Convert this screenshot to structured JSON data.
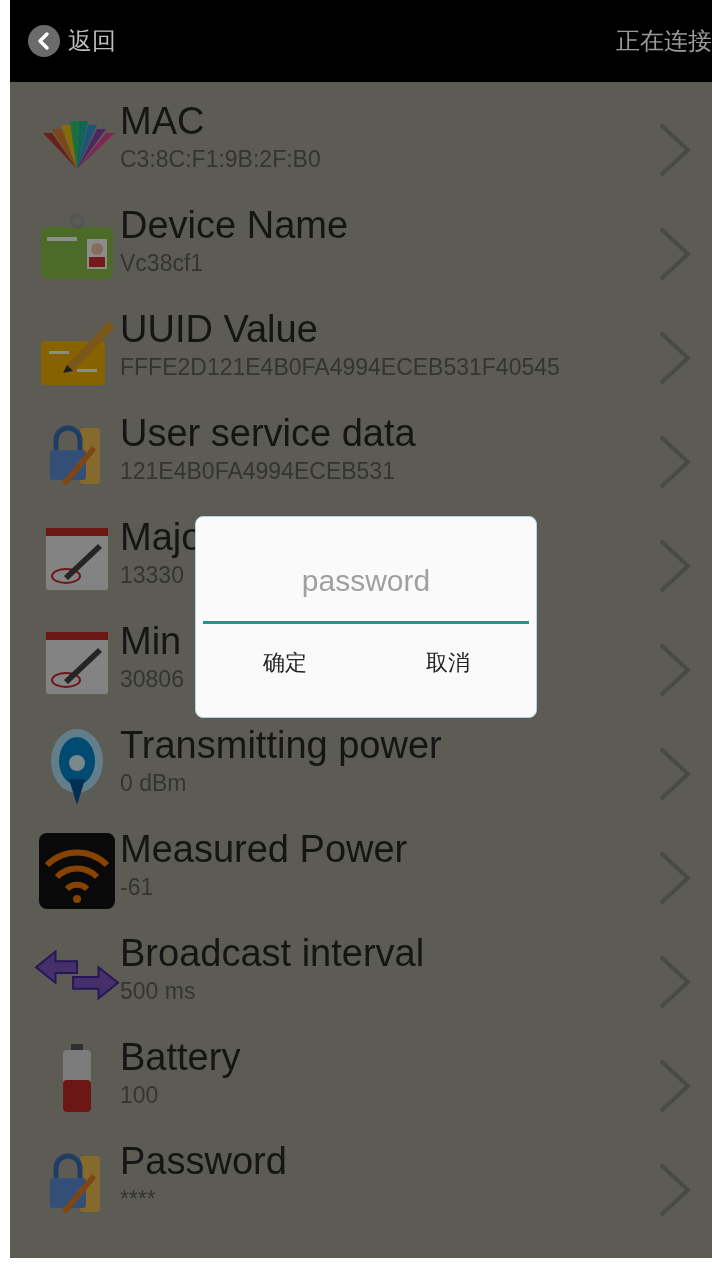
{
  "header": {
    "back_label": "返回",
    "status": "正在连接"
  },
  "items": [
    {
      "title": "MAC",
      "value": "C3:8C:F1:9B:2F:B0"
    },
    {
      "title": "Device Name",
      "value": "Vc38cf1"
    },
    {
      "title": "UUID Value",
      "value": "FFFE2D121E4B0FA4994ECEB531F40545"
    },
    {
      "title": "User service data",
      "value": "121E4B0FA4994ECEB531"
    },
    {
      "title": "Majo",
      "value": "13330"
    },
    {
      "title": "Min",
      "value": "30806"
    },
    {
      "title": "Transmitting power",
      "value": "0 dBm"
    },
    {
      "title": "Measured Power",
      "value": "-61"
    },
    {
      "title": "Broadcast interval",
      "value": "500 ms"
    },
    {
      "title": "Battery",
      "value": "100"
    },
    {
      "title": "Password",
      "value": "****"
    }
  ],
  "dialog": {
    "placeholder": "password",
    "buttons": [
      "确定",
      "取消"
    ]
  }
}
